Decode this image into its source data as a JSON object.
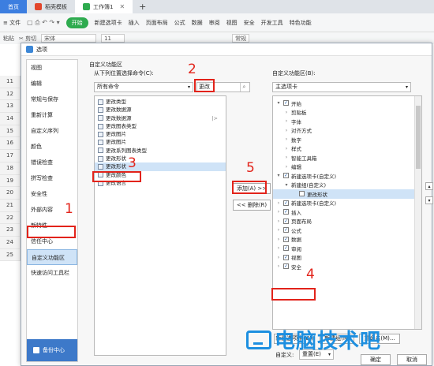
{
  "tabs": [
    {
      "label": "首页"
    },
    {
      "label": "稻壳模板"
    },
    {
      "label": "工作簿1"
    }
  ],
  "menubar": {
    "file": "≡ 文件",
    "start": "开始",
    "items": [
      "新建选项卡",
      "插入",
      "页面布局",
      "公式",
      "数据",
      "审阅",
      "视图",
      "安全",
      "开发工具",
      "特色功能"
    ]
  },
  "toolbar": {
    "cut": "剪切",
    "font": "宋体",
    "size": "11",
    "format": "常规",
    "paste": "粘贴"
  },
  "rows": [
    "11",
    "12",
    "13",
    "14",
    "15",
    "16",
    "17",
    "18",
    "19",
    "20",
    "21",
    "22",
    "23",
    "24",
    "25"
  ],
  "dialog": {
    "title": "选项",
    "nav": [
      "视图",
      "编辑",
      "常规与保存",
      "重新计算",
      "自定义序列",
      "颜色",
      "错误检查",
      "拼写检查",
      "安全性",
      "外部内容",
      "新特性",
      "信任中心",
      "自定义功能区",
      "快速访问工具栏"
    ],
    "nav_selected_index": 12,
    "backup_label": "备份中心",
    "section_title": "自定义功能区",
    "from_label": "从下列位置选择命令(C):",
    "from_value": "所有命令",
    "search_value": "更改",
    "commands": [
      {
        "label": "更改类型"
      },
      {
        "label": "更改数据源"
      },
      {
        "label": "更改数据源",
        "tail": "|>"
      },
      {
        "label": "更改图表类型"
      },
      {
        "label": "更改图片"
      },
      {
        "label": "更改图片"
      },
      {
        "label": "更改系列图表类型"
      },
      {
        "label": "更改形状"
      },
      {
        "label": "更改形状",
        "selected": true
      },
      {
        "label": "更改颜色"
      },
      {
        "label": "更改语言"
      }
    ],
    "add_button": "添加(A) >>",
    "remove_button": "<< 删除(R)",
    "ribbon_label": "自定义功能区(B):",
    "ribbon_value": "主选项卡",
    "tree": [
      {
        "label": "开始",
        "level": 0,
        "toggle": "▾",
        "checked": true
      },
      {
        "label": "剪贴板",
        "level": 1,
        "toggle": "›"
      },
      {
        "label": "字体",
        "level": 1,
        "toggle": "›"
      },
      {
        "label": "对齐方式",
        "level": 1,
        "toggle": "›"
      },
      {
        "label": "数字",
        "level": 1,
        "toggle": "›"
      },
      {
        "label": "样式",
        "level": 1,
        "toggle": "›"
      },
      {
        "label": "智能工具箱",
        "level": 1,
        "toggle": "›"
      },
      {
        "label": "编辑",
        "level": 1,
        "toggle": "›"
      },
      {
        "label": "新建选项卡(自定义)",
        "level": 0,
        "toggle": "▾",
        "checked": true
      },
      {
        "label": "新建组(自定义)",
        "level": 1,
        "toggle": "▾"
      },
      {
        "label": "更改形状",
        "level": 2,
        "selected": true,
        "icon": true
      },
      {
        "label": "新建选项卡(自定义)",
        "level": 0,
        "toggle": "›",
        "checked": true
      },
      {
        "label": "插入",
        "level": 0,
        "toggle": "›",
        "checked": true
      },
      {
        "label": "页面布局",
        "level": 0,
        "toggle": "›",
        "checked": true
      },
      {
        "label": "公式",
        "level": 0,
        "toggle": "›",
        "checked": true
      },
      {
        "label": "数据",
        "level": 0,
        "toggle": "›",
        "checked": true
      },
      {
        "label": "审阅",
        "level": 0,
        "toggle": "›",
        "checked": true
      },
      {
        "label": "视图",
        "level": 0,
        "toggle": "›",
        "checked": true
      },
      {
        "label": "安全",
        "level": 0,
        "toggle": "›",
        "checked": true
      }
    ],
    "new_tab_button": "新建选项卡(W)",
    "new_group_button": "新建组(N)",
    "rename_button": "重命名(M)...",
    "customize_label": "自定义:",
    "reset_value": "重置(E)",
    "ok_button": "确定",
    "cancel_button": "取消"
  },
  "annotations": [
    "1",
    "2",
    "3",
    "4",
    "5"
  ],
  "watermark": "电脑技术吧"
}
